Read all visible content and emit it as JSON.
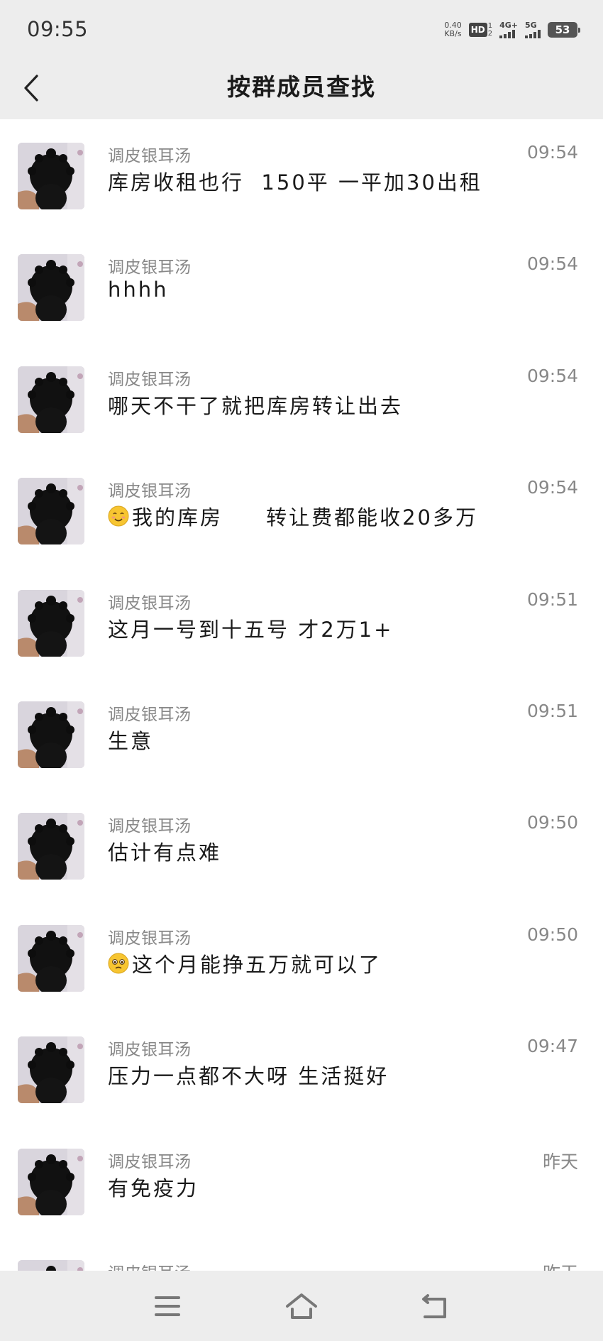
{
  "status": {
    "time": "09:55",
    "net_speed_value": "0.40",
    "net_speed_unit": "KB/s",
    "hd_label": "HD",
    "hd_sim_top": "1",
    "hd_sim_bottom": "2",
    "sim1_type": "4G+",
    "sim2_type": "5G",
    "battery": "53"
  },
  "header": {
    "back_icon": "chevron-left-icon",
    "title": "按群成员查找"
  },
  "messages": [
    {
      "sender": "调皮银耳汤",
      "time": "09:54",
      "text": "库房收租也行  150平 一平加30出租",
      "emoji": ""
    },
    {
      "sender": "调皮银耳汤",
      "time": "09:54",
      "text": "hhhh",
      "emoji": ""
    },
    {
      "sender": "调皮银耳汤",
      "time": "09:54",
      "text": "哪天不干了就把库房转让出去",
      "emoji": ""
    },
    {
      "sender": "调皮银耳汤",
      "time": "09:54",
      "text": "我的库房     转让费都能收20多万",
      "emoji": "smiling-face-icon"
    },
    {
      "sender": "调皮银耳汤",
      "time": "09:51",
      "text": "这月一号到十五号 才2万1+",
      "emoji": ""
    },
    {
      "sender": "调皮银耳汤",
      "time": "09:51",
      "text": "生意",
      "emoji": ""
    },
    {
      "sender": "调皮银耳汤",
      "time": "09:50",
      "text": "估计有点难",
      "emoji": ""
    },
    {
      "sender": "调皮银耳汤",
      "time": "09:50",
      "text": "这个月能挣五万就可以了",
      "emoji": "pleading-face-icon"
    },
    {
      "sender": "调皮银耳汤",
      "time": "09:47",
      "text": "压力一点都不大呀 生活挺好",
      "emoji": ""
    },
    {
      "sender": "调皮银耳汤",
      "time": "昨天",
      "text": "有免疫力",
      "emoji": ""
    },
    {
      "sender": "调皮银耳汤",
      "time": "昨天",
      "text": "",
      "emoji": ""
    }
  ],
  "navbar": {
    "menu_icon": "menu-icon",
    "home_icon": "home-icon",
    "back_icon": "return-icon"
  },
  "colors": {
    "bar_background": "#ededed",
    "secondary_text": "#888888",
    "primary_text": "#1a1a1a"
  }
}
